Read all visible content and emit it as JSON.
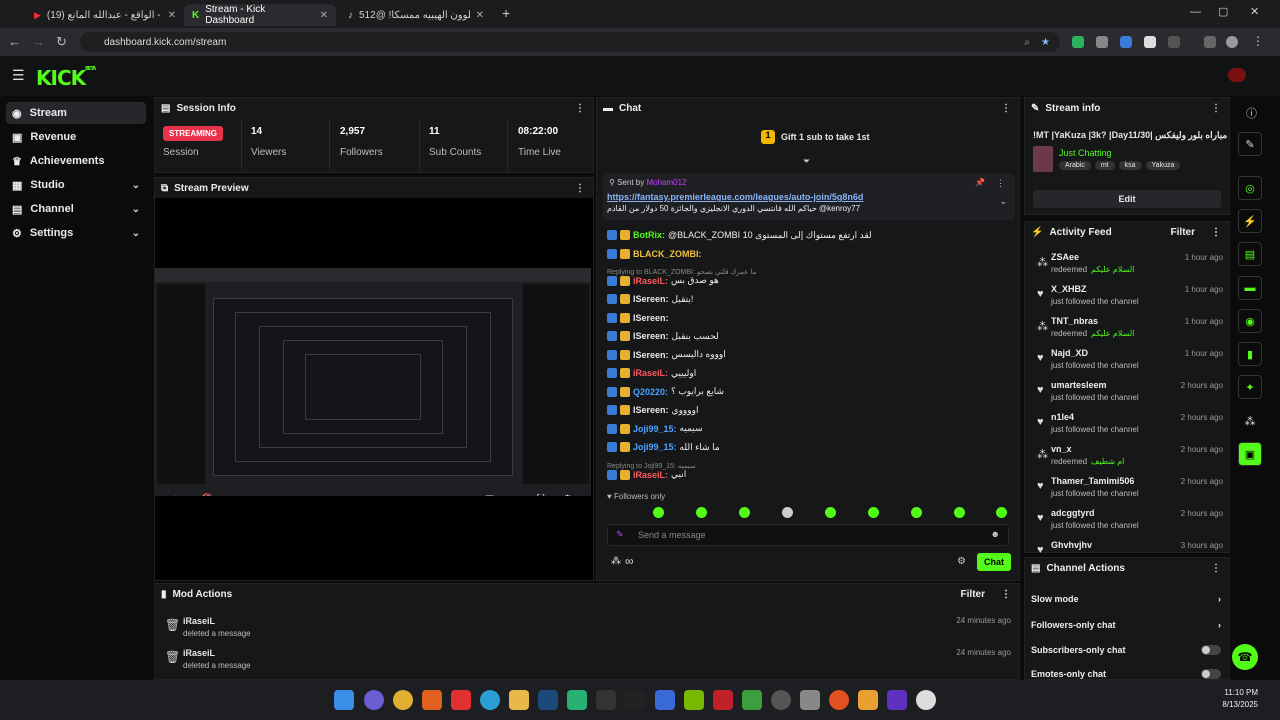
{
  "browser": {
    "tabs": [
      {
        "label": "(19) الواقع - عبدالله المانع - Tube",
        "icon": "youtube-icon"
      },
      {
        "label": "Stream - Kick Dashboard",
        "icon": "kick-icon"
      },
      {
        "label": "جلوون الهيبيه ممسكا! @512",
        "icon": "tiktok-icon"
      }
    ],
    "url": "dashboard.kick.com/stream"
  },
  "app": {
    "logo": "KICK",
    "logo_sub": "BETA",
    "brand_color": "#53fc18"
  },
  "sidebar": {
    "items": [
      {
        "label": "Stream",
        "icon": "broadcast-icon"
      },
      {
        "label": "Revenue",
        "icon": "wallet-icon"
      },
      {
        "label": "Achievements",
        "icon": "trophy-icon"
      },
      {
        "label": "Studio",
        "icon": "grid-icon"
      },
      {
        "label": "Channel",
        "icon": "channel-icon"
      },
      {
        "label": "Settings",
        "icon": "gear-icon"
      }
    ]
  },
  "session": {
    "title": "Session Info",
    "status_badge": "STREAMING",
    "status_label": "Session",
    "viewers": "14",
    "viewers_label": "Viewers",
    "followers": "2,957",
    "followers_label": "Followers",
    "subs": "11",
    "subs_label": "Sub Counts",
    "time": "08:22:00",
    "time_label": "Time Live"
  },
  "preview": {
    "title": "Stream Preview"
  },
  "mod": {
    "title": "Mod Actions",
    "filter": "Filter",
    "rows": [
      {
        "user": "iRaseiL",
        "action": "deleted a message",
        "time": "24 minutes ago"
      },
      {
        "user": "iRaseiL",
        "action": "deleted a message",
        "time": "24 minutes ago"
      }
    ]
  },
  "chat": {
    "title": "Chat",
    "gift": "Gift 1 sub to take 1st",
    "pinned_by": "Sent by",
    "pinned_user": "Moham012",
    "pinned_link": "https://fantasy.premierleague.com/leagues/auto-join/5g8n6d",
    "pinned_text": "حياكم الله فانتسي الدوري الانجليزي والجائزة 50 دولار من القادم @kenroy77",
    "messages": [
      {
        "user": "BotRix:",
        "text": "@BLACK_ZOMBI لقد ارتفع مستواك إلى المستوى 10",
        "color": "#53fc18"
      },
      {
        "user": "BLACK_ZOMBI:",
        "text": "",
        "color": "#f0c040"
      },
      {
        "user": "iRaseiL:",
        "text": "هو صدق بس",
        "color": "#ff5a5a",
        "reply": "Replying to BLACK_ZOMBI: ما عمرك قلتي تصحو"
      },
      {
        "user": "ISereen:",
        "text": "بتقبل!",
        "color": "#e8e8e8"
      },
      {
        "user": "ISereen:",
        "text": "",
        "color": "#e8e8e8"
      },
      {
        "user": "ISereen:",
        "text": "لحسب بنقبل",
        "color": "#e8e8e8"
      },
      {
        "user": "ISereen:",
        "text": "اوووه داليسس",
        "color": "#e8e8e8"
      },
      {
        "user": "iRaseiL:",
        "text": "اوليييي",
        "color": "#ff5a5a"
      },
      {
        "user": "Q20220:",
        "text": "شايع برايوب ؟",
        "color": "#4aa3ff"
      },
      {
        "user": "ISereen:",
        "text": "اووووي",
        "color": "#e8e8e8"
      },
      {
        "user": "Joji99_15:",
        "text": "سيميه",
        "color": "#4aa3ff"
      },
      {
        "user": "Joji99_15:",
        "text": "ما شاء الله",
        "color": "#4aa3ff"
      },
      {
        "user": "iRaseiL:",
        "text": "انبي",
        "color": "#ff5a5a",
        "reply": "Replying to Joji99_15: سيميه"
      }
    ],
    "followers_only": "Followers only",
    "input_placeholder": "Send a message",
    "send_label": "Chat",
    "infinite": "∞"
  },
  "stream_info": {
    "title": "Stream info",
    "stream_title": "!MT |YaKuza |3k? |Day11/30| تفتح مباراه بلور وليفكس",
    "category": "Just Chatting",
    "tags": [
      "Arabic",
      "mt",
      "ksa",
      "Yakuza"
    ],
    "edit": "Edit"
  },
  "activity": {
    "title": "Activity Feed",
    "filter": "Filter",
    "items": [
      {
        "name": "ZSAee",
        "action": "redeemed",
        "extra": "السلام عليكم",
        "time": "1 hour ago",
        "icon": "reward-icon"
      },
      {
        "name": "X_XHBZ",
        "action": "just followed the channel",
        "extra": "",
        "time": "1 hour ago",
        "icon": "heart-icon"
      },
      {
        "name": "TNT_nbras",
        "action": "redeemed",
        "extra": "السلام عليكم",
        "time": "1 hour ago",
        "icon": "reward-icon"
      },
      {
        "name": "Najd_XD",
        "action": "just followed the channel",
        "extra": "",
        "time": "1 hour ago",
        "icon": "heart-icon"
      },
      {
        "name": "umartesleem",
        "action": "just followed the channel",
        "extra": "",
        "time": "2 hours ago",
        "icon": "heart-icon"
      },
      {
        "name": "n1le4",
        "action": "just followed the channel",
        "extra": "",
        "time": "2 hours ago",
        "icon": "heart-icon"
      },
      {
        "name": "vn_x",
        "action": "redeemed",
        "extra": "ام شطيف",
        "time": "2 hours ago",
        "icon": "reward-icon"
      },
      {
        "name": "Thamer_Tamimi506",
        "action": "just followed the channel",
        "extra": "",
        "time": "2 hours ago",
        "icon": "heart-icon"
      },
      {
        "name": "adcggtyrd",
        "action": "just followed the channel",
        "extra": "",
        "time": "2 hours ago",
        "icon": "heart-icon"
      },
      {
        "name": "Ghvhvjhv",
        "action": "",
        "extra": "",
        "time": "3 hours ago",
        "icon": "heart-icon"
      }
    ]
  },
  "channel_actions": {
    "title": "Channel Actions",
    "items": [
      {
        "label": "Slow mode",
        "type": "chevron"
      },
      {
        "label": "Followers-only chat",
        "type": "chevron"
      },
      {
        "label": "Subscribers-only chat",
        "type": "toggle"
      },
      {
        "label": "Emotes-only chat",
        "type": "toggle"
      }
    ]
  },
  "taskbar": {
    "time": "11:10 PM",
    "date": "8/13/2025"
  }
}
